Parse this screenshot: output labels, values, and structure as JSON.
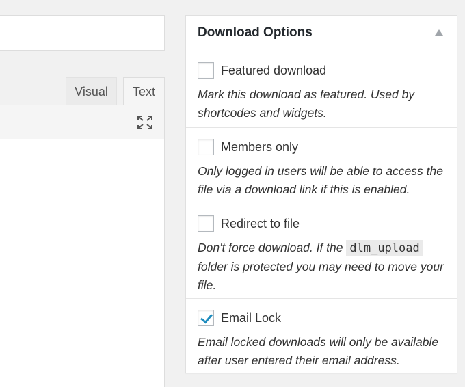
{
  "editor": {
    "tabs": [
      {
        "label": "Visual"
      },
      {
        "label": "Text"
      }
    ]
  },
  "metabox": {
    "title": "Download Options",
    "options": [
      {
        "label": "Featured download",
        "checked": false,
        "description": "Mark this download as featured. Used by shortcodes and widgets."
      },
      {
        "label": "Members only",
        "checked": false,
        "description": "Only logged in users will be able to access the file via a download link if this is enabled."
      },
      {
        "label": "Redirect to file",
        "checked": false,
        "description_before": "Don't force download. If the",
        "description_code": "dlm_upload",
        "description_after": "folder is protected you may need to move your file."
      },
      {
        "label": "Email Lock",
        "checked": true,
        "description": "Email locked downloads will only be available after user entered their email address."
      }
    ]
  },
  "colors": {
    "checkmark": "#1e8cbe",
    "background": "#f1f1f1"
  }
}
